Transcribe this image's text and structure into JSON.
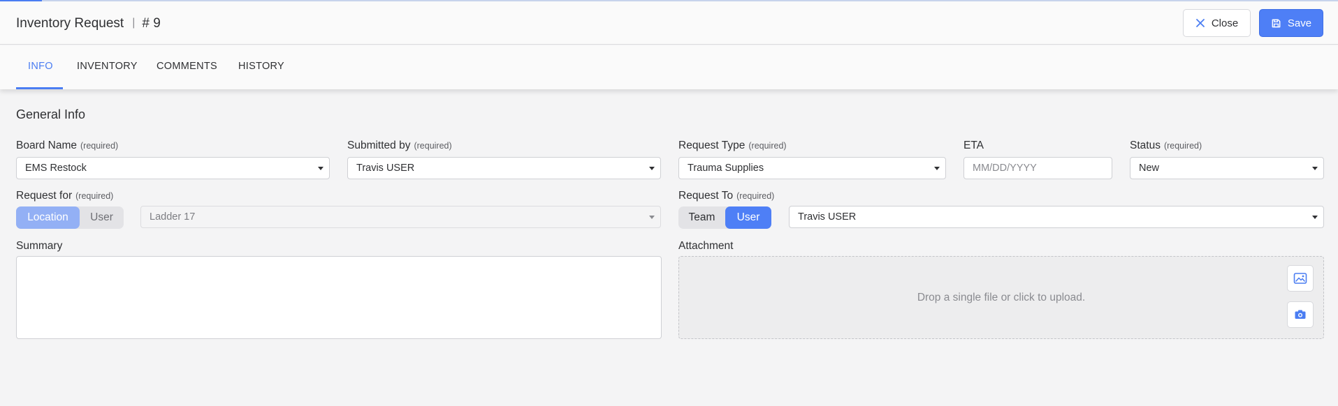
{
  "header": {
    "title": "Inventory Request",
    "separator": "|",
    "record_number": "# 9",
    "close_label": "Close",
    "save_label": "Save"
  },
  "tabs": [
    {
      "label": "INFO",
      "active": true
    },
    {
      "label": "INVENTORY",
      "active": false
    },
    {
      "label": "COMMENTS",
      "active": false
    },
    {
      "label": "HISTORY",
      "active": false
    }
  ],
  "section_title": "General Info",
  "required_text": "(required)",
  "fields": {
    "board_name": {
      "label": "Board Name",
      "value": "EMS Restock"
    },
    "submitted_by": {
      "label": "Submitted by",
      "value": "Travis USER"
    },
    "request_type": {
      "label": "Request Type",
      "value": "Trauma Supplies"
    },
    "eta": {
      "label": "ETA",
      "placeholder": "MM/DD/YYYY"
    },
    "status": {
      "label": "Status",
      "value": "New"
    },
    "request_for": {
      "label": "Request for",
      "options": [
        "Location",
        "User"
      ],
      "selected": "Location",
      "value": "Ladder 17"
    },
    "request_to": {
      "label": "Request To",
      "options": [
        "Team",
        "User"
      ],
      "selected": "User",
      "value": "Travis USER"
    },
    "summary": {
      "label": "Summary",
      "value": ""
    },
    "attachment": {
      "label": "Attachment",
      "dropzone_text": "Drop a single file or click to upload."
    }
  },
  "icons": {
    "close": "close-icon",
    "save": "save-icon",
    "image": "image-icon",
    "camera": "camera-icon"
  },
  "colors": {
    "accent": "#4e7ff6",
    "accent_muted": "#93b0f5",
    "background": "#f4f4f5"
  }
}
